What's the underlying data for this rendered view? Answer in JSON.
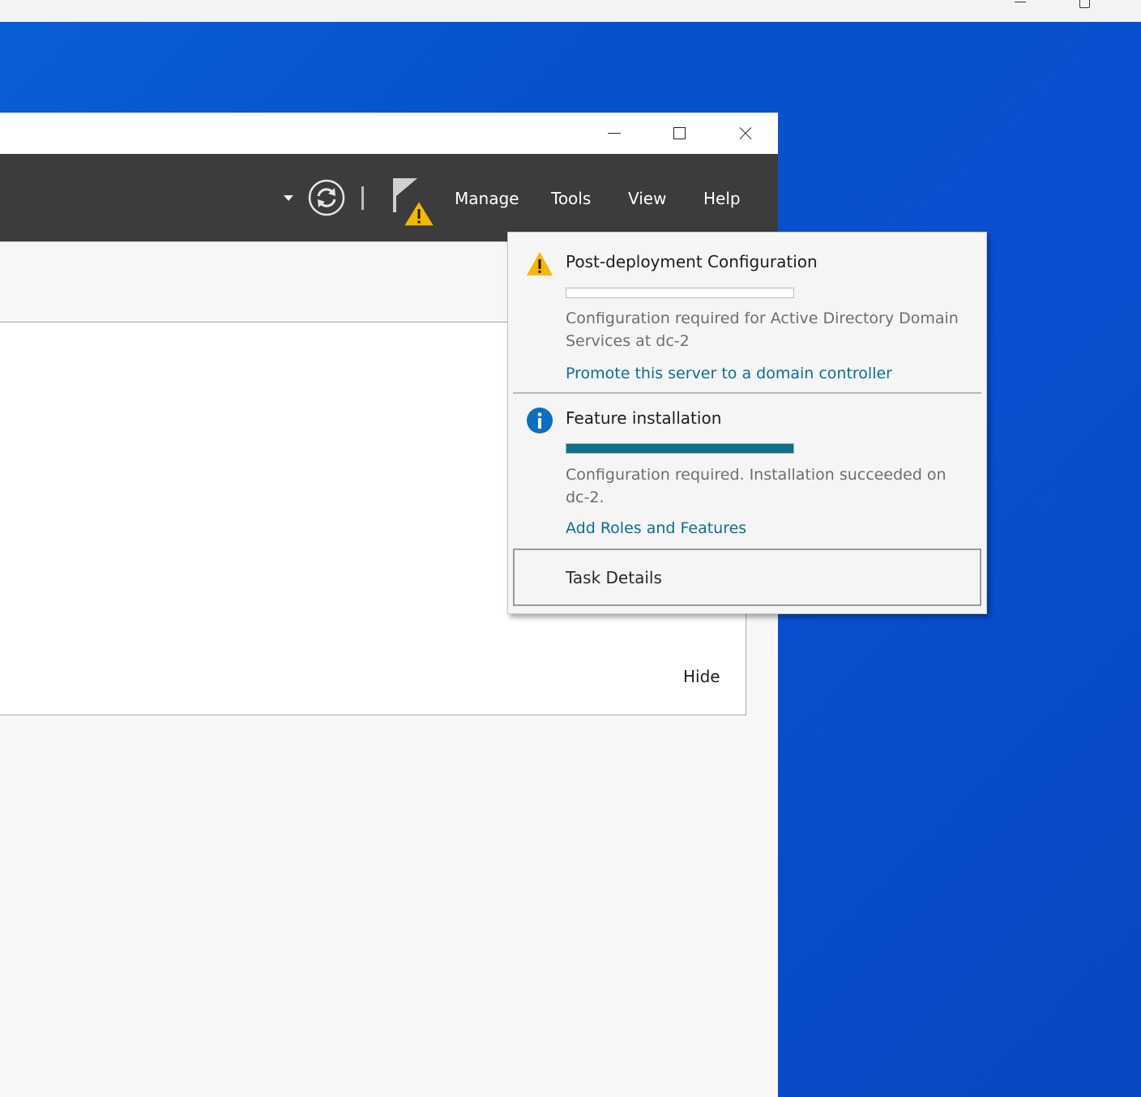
{
  "header": {
    "menu": {
      "manage": "Manage",
      "tools": "Tools",
      "view": "View",
      "help": "Help"
    }
  },
  "content": {
    "hide_label": "Hide"
  },
  "notifications": {
    "items": [
      {
        "icon": "warning-icon",
        "title": "Post-deployment Configuration",
        "progress": 0,
        "description": "Configuration required for Active Directory Domain Services at dc-2",
        "link": "Promote this server to a domain controller"
      },
      {
        "icon": "info-icon",
        "title": "Feature installation",
        "progress": 1,
        "description": "Configuration required. Installation succeeded on dc-2.",
        "link": "Add Roles and Features"
      }
    ],
    "task_details_label": "Task Details"
  },
  "colors": {
    "header_bg": "#3c3c3c",
    "link": "#0b6f92",
    "progress_fill": "#0a6f8a",
    "warning": "#f5b800",
    "info": "#0a6fc2",
    "desktop": "#0850cc"
  }
}
